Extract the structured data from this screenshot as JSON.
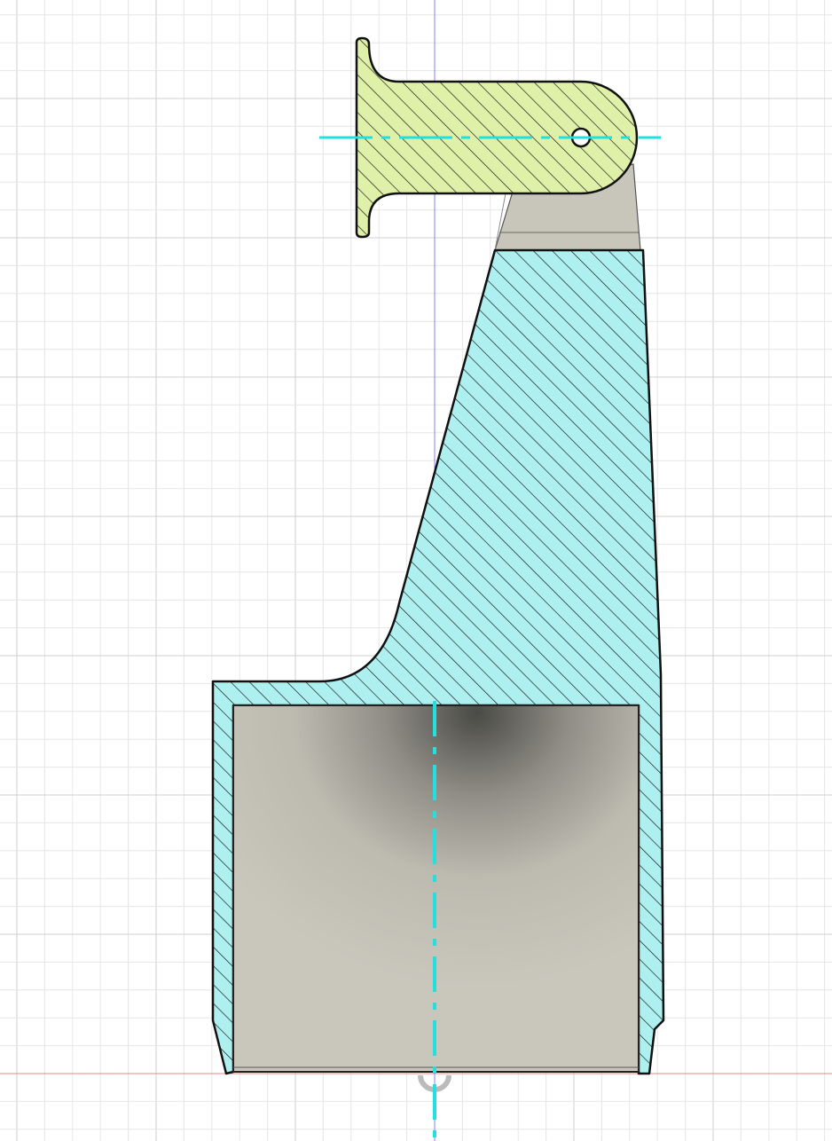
{
  "viewport": {
    "view": "section-analysis",
    "colors": {
      "background": "#ffffff",
      "grid_minor": "#e6e6e6",
      "grid_major": "#cfcfcf",
      "x_axis": "#f08080",
      "y_axis": "#8080ff",
      "centerline": "#22e0e0",
      "section_body_1": "#aef0f0",
      "section_body_2": "#dff0a8",
      "surface": "#c6c4b8",
      "outline": "#111111"
    }
  }
}
